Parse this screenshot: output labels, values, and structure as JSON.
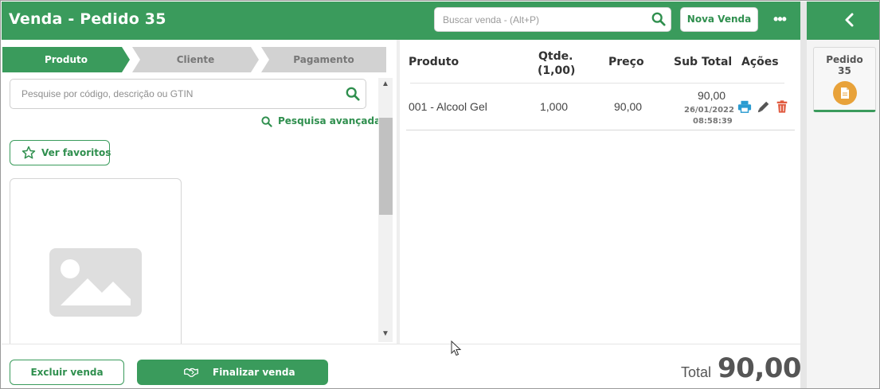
{
  "header": {
    "title": "Venda - Pedido 35",
    "search_placeholder": "Buscar venda - (Alt+P)",
    "new_sale_label": "Nova Venda",
    "more_label": "•••"
  },
  "colors": {
    "brand_green": "#3a9b5c",
    "step_inactive": "#d2d2d2",
    "accent_orange": "#e8a23a",
    "print_blue": "#2a9bd1",
    "delete_red": "#e0583d"
  },
  "steps": [
    {
      "label": "Produto",
      "active": true
    },
    {
      "label": "Cliente",
      "active": false
    },
    {
      "label": "Pagamento",
      "active": false
    }
  ],
  "product_panel": {
    "search_placeholder": "Pesquise por código, descrição ou GTIN",
    "advanced_search_label": "Pesquisa avançada",
    "favorites_label": "Ver favoritos",
    "image_placeholder_icon": "image-placeholder-icon"
  },
  "table": {
    "headers": {
      "product": "Produto",
      "qty_line1": "Qtde.",
      "qty_line2": "(1,00)",
      "price": "Preço",
      "subtotal": "Sub Total",
      "actions": "Ações"
    },
    "rows": [
      {
        "product": "001 - Alcool Gel",
        "qty": "1,000",
        "price": "90,00",
        "subtotal": "90,00",
        "date": "26/01/2022",
        "time": "08:58:39",
        "action_icons": [
          "print-icon",
          "pencil-icon",
          "trash-icon"
        ]
      }
    ]
  },
  "sidebar": {
    "back_icon": "chevron-left-icon",
    "order_label": "Pedido",
    "order_number": "35",
    "order_icon": "document-icon"
  },
  "footer": {
    "delete_label": "Excluir venda",
    "finish_label": "Finalizar venda",
    "finish_icon": "handshake-icon",
    "total_label": "Total",
    "total_value": "90,00"
  }
}
